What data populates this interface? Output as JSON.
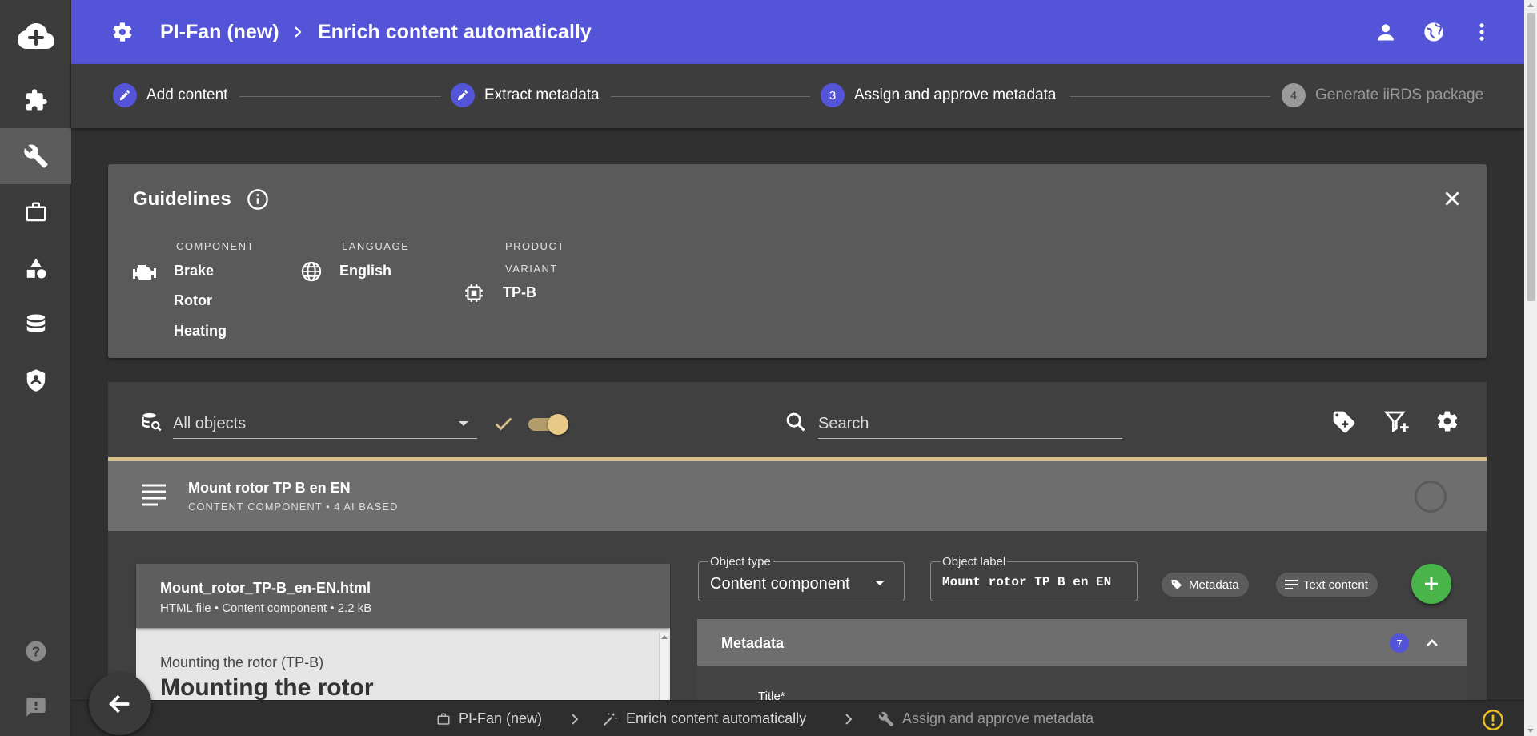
{
  "header": {
    "project": "PI-Fan (new)",
    "page": "Enrich content automatically",
    "icons": [
      "gear-icon",
      "user-icon",
      "globe-icon",
      "more-vert-icon"
    ]
  },
  "rail": {
    "items": [
      "cloud-upload-icon",
      "puzzle-icon",
      "wrench-icon",
      "briefcase-icon",
      "shapes-icon",
      "database-icon",
      "shield-icon",
      "help-icon",
      "feedback-icon"
    ],
    "active": "wrench-icon"
  },
  "stepper": {
    "steps": [
      {
        "label": "Add content",
        "state": "done"
      },
      {
        "label": "Extract metadata",
        "state": "done"
      },
      {
        "label": "Assign and approve metadata",
        "number": "3",
        "state": "active"
      },
      {
        "label": "Generate iiRDS package",
        "number": "4",
        "state": "pending"
      }
    ]
  },
  "guidelines": {
    "title": "Guidelines",
    "component": {
      "label": "COMPONENT",
      "values": [
        "Brake",
        "Rotor",
        "Heating"
      ]
    },
    "language": {
      "label": "LANGUAGE",
      "value": "English"
    },
    "product_variant": {
      "label_line1": "PRODUCT",
      "label_line2": "VARIANT",
      "value": "TP-B"
    }
  },
  "filter": {
    "select_value": "All objects",
    "search_placeholder": "Search",
    "toggle_on": true
  },
  "object": {
    "title": "Mount rotor TP B en EN",
    "subtitle": "CONTENT COMPONENT • 4 AI BASED"
  },
  "file": {
    "name": "Mount_rotor_TP-B_en-EN.html",
    "meta": "HTML file • Content component • 2.2 kB",
    "preview_subtitle": "Mounting the rotor (TP-B)",
    "preview_title": "Mounting the rotor"
  },
  "form": {
    "object_type_label": "Object type",
    "object_type_value": "Content component",
    "object_label_label": "Object label",
    "object_label_value": "Mount rotor TP B en EN",
    "chip_metadata": "Metadata",
    "chip_text_content": "Text content"
  },
  "metadata": {
    "title": "Metadata",
    "count": "7",
    "first_field": "Title*"
  },
  "bottombar": {
    "crumb1": "PI-Fan (new)",
    "crumb2": "Enrich content automatically",
    "crumb3": "Assign and approve metadata"
  },
  "colors": {
    "header": "#5454d8",
    "accent_gold": "#d8c08a",
    "fab_green": "#48b44a"
  }
}
